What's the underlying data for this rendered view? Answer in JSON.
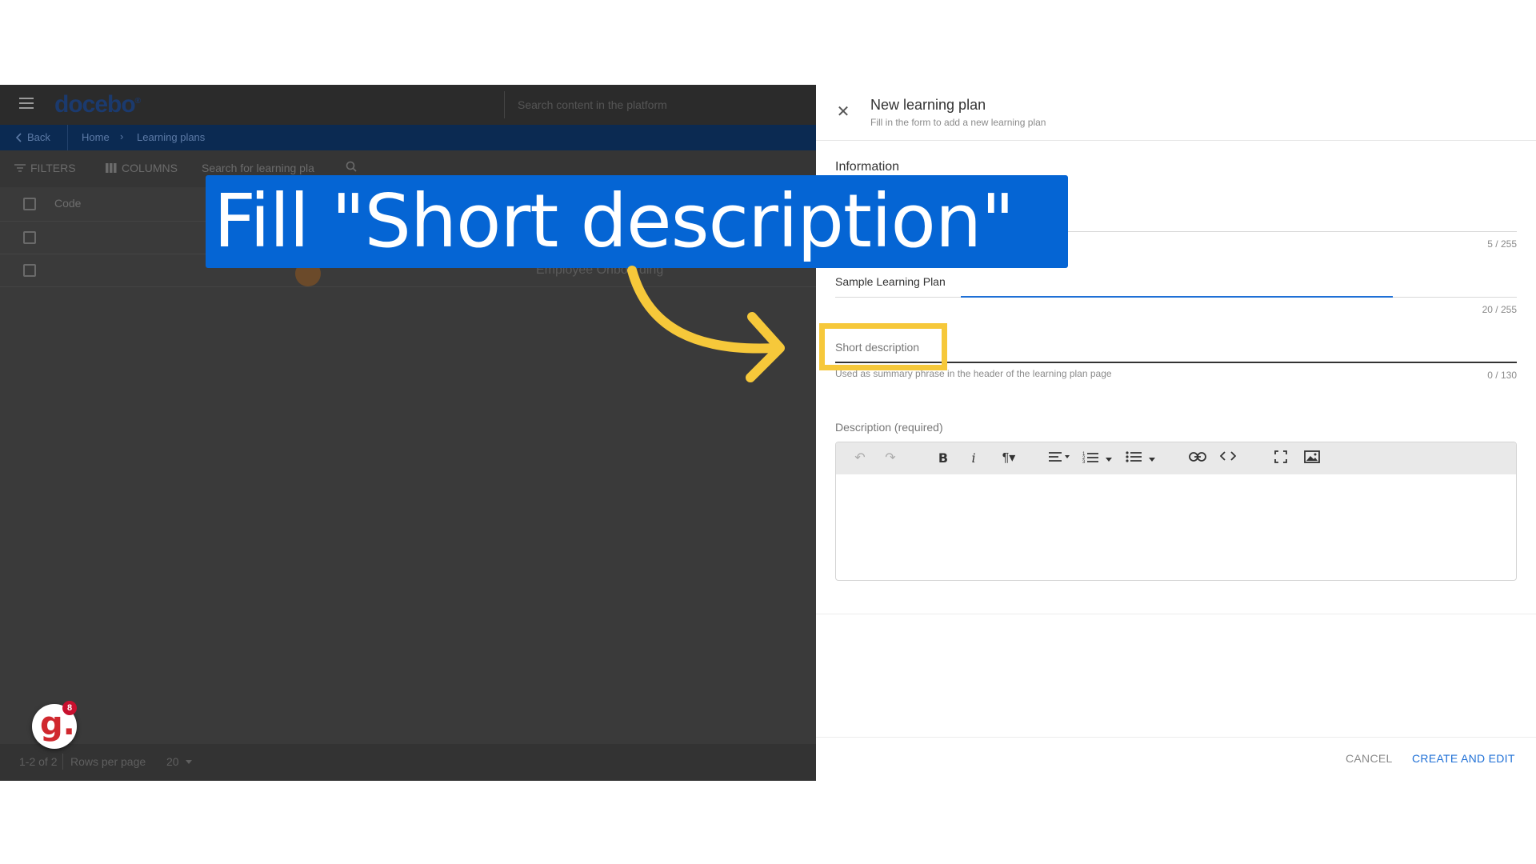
{
  "app": {
    "logo_text": "docebo",
    "logo_mark": "®",
    "search_placeholder": "Search content in the platform",
    "breadcrumb": {
      "back": "Back",
      "home": "Home",
      "current": "Learning plans"
    },
    "toolbar": {
      "filters": "FILTERS",
      "columns": "COLUMNS",
      "search_placeholder": "Search for learning pla"
    },
    "table": {
      "header_code": "Code",
      "rows": [
        {
          "name": ""
        },
        {
          "name": "Employee Onboarding"
        }
      ]
    },
    "footer": {
      "count": "1-2 of 2",
      "rows_per_page_label": "Rows per page",
      "rows_per_page_value": "20"
    },
    "help_badge": {
      "glyph": "g.",
      "count": "8"
    }
  },
  "panel": {
    "title": "New learning plan",
    "subtitle": "Fill in the form to add a new learning plan",
    "section_information": "Information",
    "code_counter": "5 / 255",
    "name_value": "Sample Learning Plan",
    "name_counter": "20 / 255",
    "short_description_label": "Short description",
    "short_description_help": "Used as summary phrase in the header of the learning plan page",
    "short_description_counter": "0 / 130",
    "description_label": "Description (required)",
    "close_glyph": "✕",
    "cancel_label": "CANCEL",
    "create_label": "CREATE AND EDIT"
  },
  "overlay": {
    "instruction": "Fill \"Short description\"",
    "banner_color": "#0565d4",
    "highlight_color": "#f6c83a"
  },
  "colors": {
    "accent": "#1f70d6",
    "dim_background": "#3a3a3a"
  }
}
